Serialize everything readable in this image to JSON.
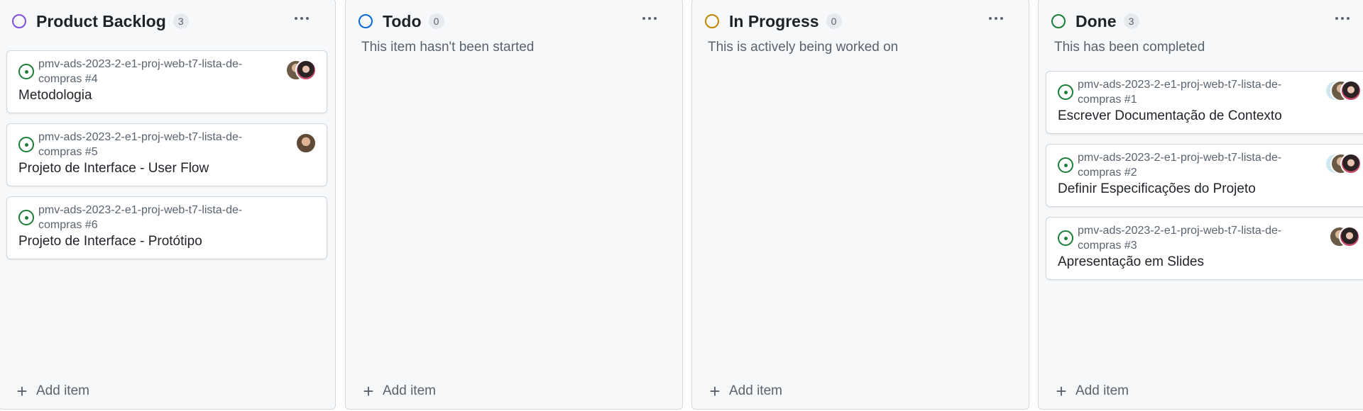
{
  "columns": [
    {
      "title": "Product Backlog",
      "count": "3",
      "status_color": "#8250df",
      "description": "",
      "add_label": "Add item",
      "cards": [
        {
          "ref": "pmv-ads-2023-2-e1-proj-web-t7-lista-de-compras #4",
          "title": "Metodologia",
          "avatars": [
            "avatar-user-a",
            "avatar-user-b"
          ]
        },
        {
          "ref": "pmv-ads-2023-2-e1-proj-web-t7-lista-de-compras #5",
          "title": "Projeto de Interface - User Flow",
          "avatars": [
            "avatar-user-c"
          ]
        },
        {
          "ref": "pmv-ads-2023-2-e1-proj-web-t7-lista-de-compras #6",
          "title": "Projeto de Interface - Protótipo",
          "avatars": []
        }
      ]
    },
    {
      "title": "Todo",
      "count": "0",
      "status_color": "#0969da",
      "description": "This item hasn't been started",
      "add_label": "Add item",
      "cards": []
    },
    {
      "title": "In Progress",
      "count": "0",
      "status_color": "#bf8700",
      "description": "This is actively being worked on",
      "add_label": "Add item",
      "cards": []
    },
    {
      "title": "Done",
      "count": "3",
      "status_color": "#1a7f37",
      "description": "This has been completed",
      "add_label": "Add item",
      "cards": [
        {
          "ref": "pmv-ads-2023-2-e1-proj-web-t7-lista-de-compras #1",
          "title": "Escrever Documentação de Contexto",
          "avatars": [
            "avatar-user-ghost",
            "avatar-user-a",
            "avatar-user-b"
          ]
        },
        {
          "ref": "pmv-ads-2023-2-e1-proj-web-t7-lista-de-compras #2",
          "title": "Definir Especificações do Projeto",
          "avatars": [
            "avatar-user-ghost",
            "avatar-user-a",
            "avatar-user-b"
          ]
        },
        {
          "ref": "pmv-ads-2023-2-e1-proj-web-t7-lista-de-compras #3",
          "title": "Apresentação em Slides",
          "avatars": [
            "avatar-user-a",
            "avatar-user-b"
          ]
        }
      ]
    }
  ],
  "icons": {
    "column_menu": "more-horizontal-icon",
    "issue": "issue-opened-icon",
    "add": "plus-icon"
  }
}
